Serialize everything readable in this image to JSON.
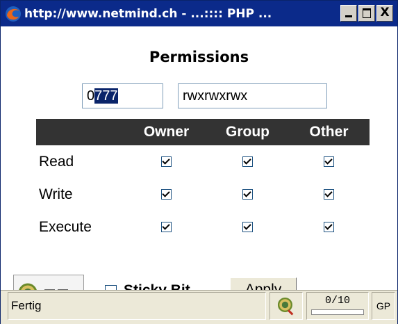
{
  "window": {
    "title": "http://www.netmind.ch - ...:::: PHP ...",
    "buttons": {
      "close": "X"
    }
  },
  "form": {
    "heading": "Permissions",
    "octal_prefix": "0",
    "octal_selected": "777",
    "symbolic_value": "rwxrwxrwx",
    "columns": [
      "Owner",
      "Group",
      "Other"
    ],
    "rows": [
      {
        "label": "Read",
        "owner": true,
        "group": true,
        "other": true
      },
      {
        "label": "Write",
        "owner": true,
        "group": true,
        "other": true
      },
      {
        "label": "Execute",
        "owner": true,
        "group": true,
        "other": true
      }
    ],
    "sticky_label": "Sticky Bit",
    "sticky_checked": false,
    "apply_label": "Apply"
  },
  "statusbar": {
    "text": "Fertig",
    "counter": "0/10",
    "gp": "GP"
  }
}
